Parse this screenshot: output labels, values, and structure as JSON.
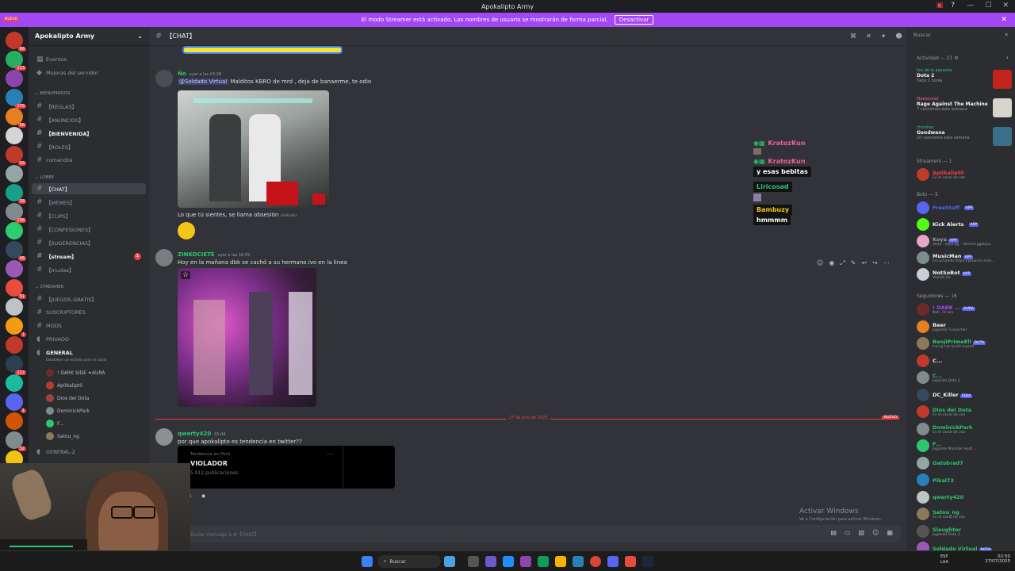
{
  "window": {
    "title": "Apokalipto Army"
  },
  "banner": {
    "text": "El modo Streamer está activado. Los nombres de usuario se mostrarán de forma parcial.",
    "button": "Desactivar"
  },
  "guilds": {
    "nuevo_label": "NUEVO",
    "badges": [
      "86",
      "123",
      "175",
      "58",
      "93",
      "39",
      "198",
      "48",
      "91",
      "1",
      "137",
      "1",
      "32"
    ]
  },
  "sidebar": {
    "server_name": "Apokalipto Army",
    "events": "Eventos",
    "server_boosts": "Mejoras del servidor",
    "categories": {
      "welcome": "BIENVENIDOS",
      "lobby": "LOBBY",
      "streamer": "STREAMER",
      "general2": "GENERAL-2"
    },
    "channels": [
      "【REGLAS】",
      "【ANUNCIOS】",
      "【BIENVENIDA】",
      "【ROLES】",
      "comandos",
      "【CHAT】",
      "【MEMES】",
      "【CLIPS】",
      "【CONFESIONES】",
      "【SUGERENCIAS】",
      "【stream】",
      "【mudae】",
      "【JUEGOS-GRATIS】",
      "SUSCRIPTORES",
      "MODS",
      "PRIVADO",
      "GENERAL",
      "GENERAL-2"
    ],
    "stream_badge": "1",
    "general_status": "Establece un estado para el canal",
    "voice_users": [
      "! DARK SIDE ✦AURA",
      "Ap0kalipt0",
      "Dios del Dota",
      "DominickPark",
      "F...",
      "Satou_ng"
    ]
  },
  "header": {
    "channel": "【CHAT】"
  },
  "messages": [
    {
      "user": "Ño",
      "time": "ayer a las 03:28",
      "mention": "@Soldado Virtual",
      "text": "Malditos KBRO de mrd , deja de banaerme, te odio",
      "caption": "Lo que tú sientes, se llama obsesión",
      "caption_meta": "(editado)"
    },
    {
      "user": "ZINKOCIETE",
      "time": "ayer a las 16:55",
      "text": "Hoy en la mañana dbk se cachó a su hermano ivo en la linea"
    },
    {
      "divider": "27 de julio de 2025",
      "new_label": "NUEVO"
    },
    {
      "user": "qwerty420",
      "time": "01:44",
      "text": "por que apokalipto es tendencia en twitter??",
      "embed_sub": "Tendencia en Perú",
      "embed_title": "VIOLADOR",
      "embed_count": "5.912 publicaciones",
      "reaction_count": "1"
    }
  ],
  "overlay_chat": [
    {
      "name": "KratozKun",
      "msg": ""
    },
    {
      "name": "KratozKun",
      "msg": "y esas bebitas"
    },
    {
      "name": "Liricosad",
      "msg": ""
    },
    {
      "name": "Bambuzy",
      "msg": "hmmmm"
    }
  ],
  "input": {
    "placeholder": "Enviar mensaje a #【CHAT】"
  },
  "members": {
    "search_placeholder": "Buscar",
    "activity_header": "Actividad — 21",
    "activities": [
      {
        "who": "fan de la payasita",
        "title": "Dota 2",
        "sub": "hace 2 horas"
      },
      {
        "who": "Masterchef",
        "title": "Rage Against The Machine",
        "sub": "7 canciones esta semana"
      },
      {
        "who": "chizohac",
        "title": "Gondwana",
        "sub": "10 canciones esta semana"
      }
    ],
    "streamers_header": "Streamers — 1",
    "streamers": [
      {
        "name": "Ap0kalipt0",
        "status": "En el canal de voz"
      }
    ],
    "bots_header": "Bots — 5",
    "bots": [
      {
        "name": "FreeStuff",
        "tag": "APP",
        "status": ""
      },
      {
        "name": "Kick Alerts",
        "tag": "APP",
        "status": ""
      },
      {
        "name": "Koya",
        "tag": "APP",
        "status": "/help - koya.gg - discord.gg/koya"
      },
      {
        "name": "MusicMan",
        "tag": "APP",
        "status": "Escuchando https://playlists.mon..."
      },
      {
        "name": "NotSoBot",
        "tag": "APP",
        "status": "Viendo for"
      }
    ],
    "followers_header": "Seguidores — 16",
    "followers": [
      {
        "name": "! DARK ...",
        "tag": "AURA",
        "status": "Nah, i'd win"
      },
      {
        "name": "Beer",
        "tag": "",
        "status": "Jugando TLauncher"
      },
      {
        "name": "BenjiPrimeEll",
        "tag": "DOTA",
        "status": "trying not to kill myself"
      },
      {
        "name": "C...",
        "tag": "",
        "status": ""
      },
      {
        "name": "C...",
        "tag": "",
        "status": "Jugando Dota 2"
      },
      {
        "name": "DC_Killer",
        "tag": "FEKA",
        "status": ""
      },
      {
        "name": "Dios del Dota",
        "tag": "",
        "status": "En el canal de voz"
      },
      {
        "name": "DominickPark",
        "tag": "",
        "status": "En el canal de voz"
      },
      {
        "name": "F...",
        "tag": "",
        "status": "Jugando Monster Hunt..."
      },
      {
        "name": "Gatobrad7",
        "tag": "",
        "status": ""
      },
      {
        "name": "Pikal72",
        "tag": "",
        "status": ""
      },
      {
        "name": "qwerty420",
        "tag": "",
        "status": ""
      },
      {
        "name": "Satou_ng",
        "tag": "",
        "status": "En el canal de voz"
      },
      {
        "name": "Slaughter",
        "tag": "",
        "status": "Jugando Dota 2"
      },
      {
        "name": "Soldado Virtual",
        "tag": "DOTA",
        "status": ""
      }
    ]
  },
  "watermark": {
    "line1": "Activar Windows",
    "line2": "Ve a Configuración para activar Windows."
  },
  "taskbar": {
    "search": "Buscar",
    "lang": "ESP LAA",
    "time": "02:50",
    "date": "27/07/2025"
  },
  "colors": {
    "banner": "#a347f5",
    "green_name": "#2dc770",
    "accent": "#5865f2",
    "red_badge": "#f23f42"
  }
}
